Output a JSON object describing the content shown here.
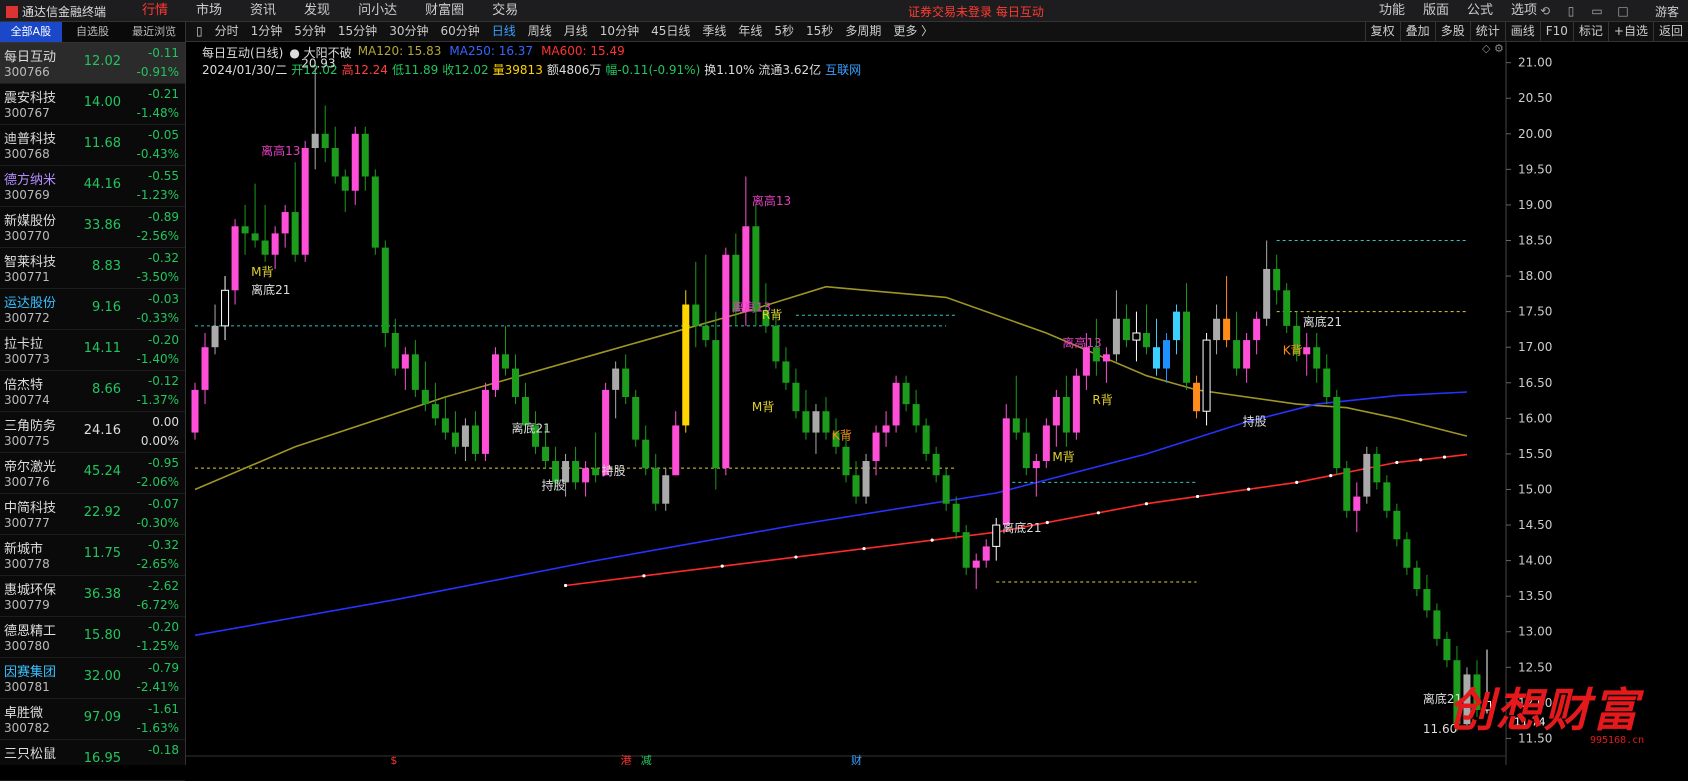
{
  "window": {
    "app_title": "通达信金融终端",
    "menu": [
      "行情",
      "市场",
      "资讯",
      "发现",
      "问小达",
      "财富圈",
      "交易"
    ],
    "active_menu": "行情",
    "login_status": "证券交易未登录   每日互动",
    "right_menu": [
      "功能",
      "版面",
      "公式",
      "选项"
    ],
    "guest": "游客"
  },
  "sidebar": {
    "tabs": [
      "全部A股",
      "自选股",
      "最近浏览"
    ],
    "active_tab": "全部A股",
    "stocks": [
      {
        "name": "每日互动",
        "code": "300766",
        "price": "12.02",
        "change": "-0.11",
        "pct": "-0.91%",
        "selected": true
      },
      {
        "name": "震安科技",
        "code": "300767",
        "price": "14.00",
        "change": "-0.21",
        "pct": "-1.48%"
      },
      {
        "name": "迪普科技",
        "code": "300768",
        "price": "11.68",
        "change": "-0.05",
        "pct": "-0.43%"
      },
      {
        "name": "德方纳米",
        "code": "300769",
        "price": "44.16",
        "change": "-0.55",
        "pct": "-1.23%",
        "name_color": "#b38cff"
      },
      {
        "name": "新媒股份",
        "code": "300770",
        "price": "33.86",
        "change": "-0.89",
        "pct": "-2.56%"
      },
      {
        "name": "智莱科技",
        "code": "300771",
        "price": "8.83",
        "change": "-0.32",
        "pct": "-3.50%"
      },
      {
        "name": "运达股份",
        "code": "300772",
        "price": "9.16",
        "change": "-0.03",
        "pct": "-0.33%",
        "name_color": "#39c2ff"
      },
      {
        "name": "拉卡拉",
        "code": "300773",
        "price": "14.11",
        "change": "-0.20",
        "pct": "-1.40%"
      },
      {
        "name": "倍杰特",
        "code": "300774",
        "price": "8.66",
        "change": "-0.12",
        "pct": "-1.37%"
      },
      {
        "name": "三角防务",
        "code": "300775",
        "price": "24.16",
        "change": "0.00",
        "pct": "0.00%",
        "flat": true
      },
      {
        "name": "帝尔激光",
        "code": "300776",
        "price": "45.24",
        "change": "-0.95",
        "pct": "-2.06%"
      },
      {
        "name": "中简科技",
        "code": "300777",
        "price": "22.92",
        "change": "-0.07",
        "pct": "-0.30%"
      },
      {
        "name": "新城市",
        "code": "300778",
        "price": "11.75",
        "change": "-0.32",
        "pct": "-2.65%"
      },
      {
        "name": "惠城环保",
        "code": "300779",
        "price": "36.38",
        "change": "-2.62",
        "pct": "-6.72%"
      },
      {
        "name": "德恩精工",
        "code": "300780",
        "price": "15.80",
        "change": "-0.20",
        "pct": "-1.25%"
      },
      {
        "name": "因赛集团",
        "code": "300781",
        "price": "32.00",
        "change": "-0.79",
        "pct": "-2.41%",
        "name_color": "#39c2ff"
      },
      {
        "name": "卓胜微",
        "code": "300782",
        "price": "97.09",
        "change": "-1.61",
        "pct": "-1.63%"
      },
      {
        "name": "三只松鼠",
        "code": "",
        "price": "16.95",
        "change": "-0.18",
        "pct": ""
      }
    ]
  },
  "periods": {
    "items": [
      "分时",
      "1分钟",
      "5分钟",
      "15分钟",
      "30分钟",
      "60分钟",
      "日线",
      "周线",
      "月线",
      "10分钟",
      "45日线",
      "季线",
      "年线",
      "5秒",
      "15秒",
      "多周期",
      "更多 〉"
    ],
    "active": "日线",
    "tools": [
      "复权",
      "叠加",
      "多股",
      "统计",
      "画线",
      "F10",
      "标记",
      "+自选",
      "返回"
    ]
  },
  "info": {
    "title": "每日互动(日线)",
    "indicator": "大阳不破",
    "ma": [
      {
        "label": "MA120: 15.83",
        "color": "#b5a733"
      },
      {
        "label": "MA250: 16.37",
        "color": "#3366ff"
      },
      {
        "label": "MA600: 15.49",
        "color": "#ff3333"
      }
    ],
    "date": "2024/01/30/二",
    "stats": [
      {
        "text": "开12.02",
        "color": "#22c55e"
      },
      {
        "text": "高12.24",
        "color": "#ff4040"
      },
      {
        "text": "低11.89",
        "color": "#22c55e"
      },
      {
        "text": "收12.02",
        "color": "#22c55e"
      },
      {
        "text": "量39813",
        "color": "#ffd400"
      },
      {
        "text": "额4806万",
        "color": "#ddd"
      },
      {
        "text": "幅-0.11(-0.91%)",
        "color": "#22c55e"
      },
      {
        "text": "换1.10%",
        "color": "#ddd"
      },
      {
        "text": "流通3.62亿",
        "color": "#ddd"
      },
      {
        "text": "互联网",
        "color": "#3aa0ff"
      }
    ]
  },
  "chart_data": {
    "type": "candlestick",
    "y_range": [
      11.45,
      21.15
    ],
    "y_ticks": [
      "21.00",
      "20.50",
      "20.00",
      "19.50",
      "19.00",
      "18.50",
      "18.00",
      "17.50",
      "17.00",
      "16.50",
      "16.00",
      "15.50",
      "15.00",
      "14.50",
      "14.00",
      "13.50",
      "13.00",
      "12.50",
      "12.00",
      "11.50"
    ],
    "candles": [
      [
        15.8,
        16.5,
        15.7,
        16.4
      ],
      [
        16.4,
        17.2,
        16.2,
        17.0
      ],
      [
        17.0,
        17.6,
        16.9,
        17.3
      ],
      [
        17.3,
        18.0,
        17.1,
        17.8
      ],
      [
        17.8,
        18.8,
        17.6,
        18.7
      ],
      [
        18.7,
        19.0,
        18.3,
        18.6
      ],
      [
        18.6,
        19.3,
        18.4,
        18.5
      ],
      [
        18.5,
        19.0,
        18.2,
        18.3
      ],
      [
        18.3,
        18.7,
        18.1,
        18.6
      ],
      [
        18.6,
        19.0,
        18.4,
        18.9
      ],
      [
        18.9,
        19.6,
        18.2,
        18.3
      ],
      [
        18.3,
        19.9,
        18.2,
        19.8
      ],
      [
        19.8,
        20.93,
        19.5,
        20.0
      ],
      [
        20.0,
        20.4,
        19.6,
        19.8
      ],
      [
        19.8,
        20.1,
        19.3,
        19.4
      ],
      [
        19.4,
        19.5,
        18.9,
        19.2
      ],
      [
        19.2,
        20.1,
        19.0,
        20.0
      ],
      [
        20.0,
        20.1,
        19.2,
        19.4
      ],
      [
        19.4,
        19.5,
        18.3,
        18.4
      ],
      [
        18.4,
        18.5,
        17.0,
        17.2
      ],
      [
        17.2,
        17.4,
        16.6,
        16.7
      ],
      [
        16.7,
        17.0,
        16.4,
        16.9
      ],
      [
        16.9,
        17.1,
        16.3,
        16.4
      ],
      [
        16.4,
        16.8,
        16.1,
        16.2
      ],
      [
        16.2,
        16.5,
        15.9,
        16.0
      ],
      [
        16.0,
        16.3,
        15.7,
        15.8
      ],
      [
        15.8,
        16.1,
        15.5,
        15.6
      ],
      [
        15.6,
        16.0,
        15.4,
        15.9
      ],
      [
        15.9,
        16.1,
        15.4,
        15.5
      ],
      [
        15.5,
        16.5,
        15.4,
        16.4
      ],
      [
        16.4,
        17.0,
        16.3,
        16.9
      ],
      [
        16.9,
        17.3,
        16.6,
        16.7
      ],
      [
        16.7,
        16.9,
        16.2,
        16.3
      ],
      [
        16.3,
        16.5,
        15.8,
        15.9
      ],
      [
        15.9,
        16.1,
        15.5,
        15.6
      ],
      [
        15.6,
        15.9,
        15.3,
        15.4
      ],
      [
        15.4,
        15.6,
        15.0,
        15.1
      ],
      [
        15.1,
        15.5,
        14.9,
        15.4
      ],
      [
        15.4,
        15.6,
        15.0,
        15.1
      ],
      [
        15.1,
        15.4,
        14.9,
        15.3
      ],
      [
        15.3,
        15.8,
        15.1,
        15.2
      ],
      [
        15.2,
        16.5,
        15.2,
        16.4
      ],
      [
        16.4,
        16.8,
        16.0,
        16.7
      ],
      [
        16.7,
        16.9,
        16.2,
        16.3
      ],
      [
        16.3,
        16.4,
        15.6,
        15.7
      ],
      [
        15.7,
        15.9,
        15.2,
        15.3
      ],
      [
        15.3,
        15.5,
        14.7,
        14.8
      ],
      [
        14.8,
        15.3,
        14.7,
        15.2
      ],
      [
        15.2,
        16.1,
        15.2,
        15.9
      ],
      [
        15.9,
        17.8,
        15.8,
        17.6
      ],
      [
        17.6,
        18.2,
        17.0,
        17.3
      ],
      [
        17.3,
        18.3,
        17.0,
        17.1
      ],
      [
        17.1,
        17.5,
        15.0,
        15.3
      ],
      [
        15.3,
        18.4,
        15.2,
        18.3
      ],
      [
        18.3,
        18.6,
        17.3,
        17.5
      ],
      [
        17.5,
        19.4,
        17.3,
        18.7
      ],
      [
        18.7,
        19.0,
        17.3,
        17.5
      ],
      [
        17.5,
        17.9,
        17.2,
        17.3
      ],
      [
        17.3,
        17.5,
        16.7,
        16.8
      ],
      [
        16.8,
        17.0,
        16.4,
        16.5
      ],
      [
        16.5,
        16.7,
        16.0,
        16.1
      ],
      [
        16.1,
        16.4,
        15.7,
        15.8
      ],
      [
        15.8,
        16.2,
        15.5,
        16.1
      ],
      [
        16.1,
        16.3,
        15.7,
        15.8
      ],
      [
        15.8,
        16.0,
        15.5,
        15.6
      ],
      [
        15.6,
        15.8,
        15.1,
        15.2
      ],
      [
        15.2,
        15.4,
        14.8,
        14.9
      ],
      [
        14.9,
        15.5,
        14.8,
        15.4
      ],
      [
        15.4,
        15.9,
        15.2,
        15.8
      ],
      [
        15.8,
        16.1,
        15.6,
        15.9
      ],
      [
        15.9,
        16.6,
        15.8,
        16.5
      ],
      [
        16.5,
        16.6,
        16.1,
        16.2
      ],
      [
        16.2,
        16.4,
        15.8,
        15.9
      ],
      [
        15.9,
        16.0,
        15.4,
        15.5
      ],
      [
        15.5,
        15.6,
        15.1,
        15.2
      ],
      [
        15.2,
        15.3,
        14.7,
        14.8
      ],
      [
        14.8,
        14.9,
        14.3,
        14.4
      ],
      [
        14.4,
        14.5,
        13.8,
        13.9
      ],
      [
        13.9,
        14.1,
        13.6,
        14.0
      ],
      [
        14.0,
        14.3,
        13.9,
        14.2
      ],
      [
        14.2,
        14.6,
        14.0,
        14.5
      ],
      [
        14.5,
        16.2,
        14.4,
        16.0
      ],
      [
        16.0,
        16.6,
        15.7,
        15.8
      ],
      [
        15.8,
        16.0,
        15.2,
        15.3
      ],
      [
        15.3,
        15.5,
        14.9,
        15.4
      ],
      [
        15.4,
        16.0,
        15.3,
        15.9
      ],
      [
        15.9,
        16.4,
        15.6,
        16.3
      ],
      [
        16.3,
        16.6,
        15.6,
        15.8
      ],
      [
        15.8,
        16.7,
        15.7,
        16.6
      ],
      [
        16.6,
        17.2,
        16.4,
        17.0
      ],
      [
        17.0,
        17.4,
        16.6,
        16.8
      ],
      [
        16.8,
        17.0,
        16.5,
        16.9
      ],
      [
        16.9,
        17.8,
        16.8,
        17.4
      ],
      [
        17.4,
        17.6,
        17.0,
        17.1
      ],
      [
        17.1,
        17.5,
        16.8,
        17.2
      ],
      [
        17.2,
        17.6,
        16.9,
        17.0
      ],
      [
        17.0,
        17.4,
        16.6,
        16.7
      ],
      [
        16.7,
        17.2,
        16.5,
        17.1
      ],
      [
        17.1,
        17.6,
        16.9,
        17.5
      ],
      [
        17.5,
        17.9,
        16.4,
        16.5
      ],
      [
        16.5,
        16.6,
        16.0,
        16.1
      ],
      [
        16.1,
        17.2,
        15.9,
        17.1
      ],
      [
        17.1,
        17.6,
        16.9,
        17.4
      ],
      [
        17.4,
        18.0,
        17.0,
        17.1
      ],
      [
        17.1,
        17.5,
        16.6,
        16.7
      ],
      [
        16.7,
        17.2,
        16.5,
        17.1
      ],
      [
        17.1,
        17.5,
        16.9,
        17.4
      ],
      [
        17.4,
        18.5,
        17.3,
        18.1
      ],
      [
        18.1,
        18.3,
        17.6,
        17.8
      ],
      [
        17.8,
        17.9,
        17.2,
        17.3
      ],
      [
        17.3,
        17.5,
        16.8,
        16.9
      ],
      [
        16.9,
        17.2,
        16.6,
        17.0
      ],
      [
        17.0,
        17.2,
        16.5,
        16.7
      ],
      [
        16.7,
        16.9,
        16.2,
        16.3
      ],
      [
        16.3,
        16.4,
        15.2,
        15.3
      ],
      [
        15.3,
        15.4,
        14.6,
        14.7
      ],
      [
        14.7,
        15.1,
        14.4,
        14.9
      ],
      [
        14.9,
        15.6,
        14.8,
        15.5
      ],
      [
        15.5,
        15.6,
        15.0,
        15.1
      ],
      [
        15.1,
        15.2,
        14.6,
        14.7
      ],
      [
        14.7,
        14.8,
        14.2,
        14.3
      ],
      [
        14.3,
        14.4,
        13.8,
        13.9
      ],
      [
        13.9,
        14.0,
        13.5,
        13.6
      ],
      [
        13.6,
        13.8,
        13.2,
        13.3
      ],
      [
        13.3,
        13.4,
        12.8,
        12.9
      ],
      [
        12.9,
        13.0,
        12.5,
        12.6
      ],
      [
        12.6,
        12.8,
        11.6,
        11.7
      ],
      [
        11.7,
        12.5,
        11.65,
        12.4
      ],
      [
        12.4,
        12.6,
        11.8,
        11.9
      ],
      [
        11.9,
        12.75,
        11.85,
        12.02
      ]
    ],
    "ma120": [
      [
        0,
        15.0
      ],
      [
        10,
        15.6
      ],
      [
        25,
        16.3
      ],
      [
        40,
        16.9
      ],
      [
        55,
        17.5
      ],
      [
        63,
        17.85
      ],
      [
        75,
        17.7
      ],
      [
        85,
        17.2
      ],
      [
        95,
        16.6
      ],
      [
        100,
        16.4
      ],
      [
        110,
        16.2
      ],
      [
        115,
        16.15
      ],
      [
        120,
        16.0
      ],
      [
        127,
        15.75
      ]
    ],
    "ma250": [
      [
        0,
        12.95
      ],
      [
        20,
        13.45
      ],
      [
        40,
        14.0
      ],
      [
        60,
        14.5
      ],
      [
        80,
        14.95
      ],
      [
        95,
        15.5
      ],
      [
        105,
        15.95
      ],
      [
        112,
        16.2
      ],
      [
        120,
        16.32
      ],
      [
        127,
        16.37
      ]
    ],
    "ma600": [
      [
        37,
        13.65
      ],
      [
        60,
        14.05
      ],
      [
        80,
        14.4
      ],
      [
        95,
        14.8
      ],
      [
        110,
        15.1
      ],
      [
        120,
        15.38
      ],
      [
        127,
        15.49
      ]
    ],
    "levels": [
      {
        "y": 17.3,
        "x0": 0,
        "x1": 75,
        "color": "#2ec4c4"
      },
      {
        "y": 15.3,
        "x0": 0,
        "x1": 76,
        "color": "#e0d030"
      },
      {
        "y": 17.45,
        "x0": 60,
        "x1": 76,
        "color": "#2ec4c4"
      },
      {
        "y": 15.1,
        "x0": 81,
        "x1": 100,
        "color": "#2ec4c4"
      },
      {
        "y": 13.7,
        "x0": 80,
        "x1": 100,
        "color": "#e0d030"
      },
      {
        "y": 18.5,
        "x0": 108,
        "x1": 127,
        "color": "#2ec4c4"
      },
      {
        "y": 17.5,
        "x0": 108,
        "x1": 127,
        "color": "#e0d030"
      }
    ],
    "labels": [
      {
        "i": 12,
        "y": 20.93,
        "text": "20.93",
        "color": "#dddddd"
      },
      {
        "i": 7,
        "y": 18.0,
        "text": "M背",
        "color": "#e0d030"
      },
      {
        "i": 7,
        "y": 17.75,
        "text": "离底21",
        "color": "#dddddd"
      },
      {
        "i": 8,
        "y": 19.7,
        "text": "离高13",
        "color": "#e040c0"
      },
      {
        "i": 42,
        "y": 15.2,
        "text": "持股",
        "color": "#dddddd"
      },
      {
        "i": 33,
        "y": 15.8,
        "text": "离底21",
        "color": "#dddddd"
      },
      {
        "i": 36,
        "y": 15.0,
        "text": "持股",
        "color": "#dddddd"
      },
      {
        "i": 55,
        "y": 17.5,
        "text": "离高13",
        "color": "#e040c0"
      },
      {
        "i": 57,
        "y": 19.0,
        "text": "离高13",
        "color": "#e040c0"
      },
      {
        "i": 58,
        "y": 17.4,
        "text": "R背",
        "color": "#e0d030"
      },
      {
        "i": 57,
        "y": 16.1,
        "text": "M背",
        "color": "#e0d030"
      },
      {
        "i": 65,
        "y": 15.7,
        "text": "K背",
        "color": "#ff8c1a"
      },
      {
        "i": 82,
        "y": 14.4,
        "text": "离底21",
        "color": "#dddddd"
      },
      {
        "i": 87,
        "y": 15.4,
        "text": "M背",
        "color": "#e0d030"
      },
      {
        "i": 88,
        "y": 17.0,
        "text": "离高13",
        "color": "#e040c0"
      },
      {
        "i": 91,
        "y": 16.2,
        "text": "R背",
        "color": "#e0d030"
      },
      {
        "i": 106,
        "y": 15.9,
        "text": "持股",
        "color": "#dddddd"
      },
      {
        "i": 112,
        "y": 17.3,
        "text": "离底21",
        "color": "#dddddd"
      },
      {
        "i": 110,
        "y": 16.9,
        "text": "K背",
        "color": "#ff8c1a"
      },
      {
        "i": 124,
        "y": 12.0,
        "text": "离底21",
        "color": "#dddddd"
      },
      {
        "i": 124,
        "y": 11.58,
        "text": "11.60",
        "color": "#dddddd"
      }
    ],
    "markers": [
      {
        "i": 20,
        "text": "$",
        "color": "#ff3030"
      },
      {
        "i": 43,
        "text": "港",
        "color": "#ff3030"
      },
      {
        "i": 45,
        "text": "减",
        "color": "#22c55e"
      },
      {
        "i": 66,
        "text": "财",
        "color": "#3aa0ff"
      }
    ],
    "current_price": "11.74"
  },
  "watermark": {
    "text": "创想财富",
    "url": "995168.cn"
  }
}
